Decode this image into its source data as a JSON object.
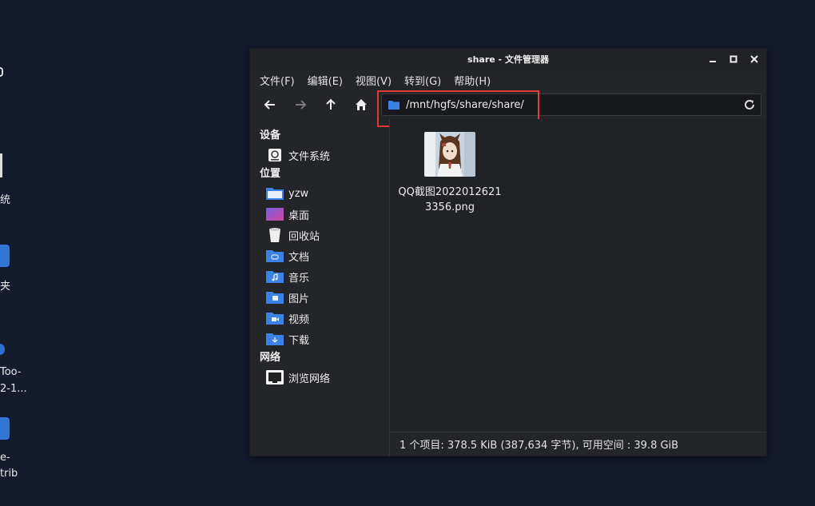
{
  "desktop": {
    "labels": [
      "统",
      "夹",
      "Too-",
      "2-1...",
      "e-",
      "trib"
    ]
  },
  "window": {
    "title": "share - 文件管理器"
  },
  "menu": [
    "文件(F)",
    "编辑(E)",
    "视图(V)",
    "转到(G)",
    "帮助(H)"
  ],
  "address": {
    "path": "/mnt/hgfs/share/share/"
  },
  "sidebar": {
    "sections": {
      "devices": "设备",
      "places": "位置",
      "network": "网络"
    },
    "devices": [
      {
        "label": "文件系统",
        "icon": "drive-icon"
      }
    ],
    "places": [
      {
        "label": "yzw",
        "icon": "home-folder-icon"
      },
      {
        "label": "桌面",
        "icon": "desktop-icon"
      },
      {
        "label": "回收站",
        "icon": "trash-icon"
      },
      {
        "label": "文档",
        "icon": "documents-folder-icon"
      },
      {
        "label": "音乐",
        "icon": "music-folder-icon"
      },
      {
        "label": "图片",
        "icon": "pictures-folder-icon"
      },
      {
        "label": "视频",
        "icon": "videos-folder-icon"
      },
      {
        "label": "下载",
        "icon": "downloads-folder-icon"
      }
    ],
    "network": [
      {
        "label": "浏览网络",
        "icon": "network-icon"
      }
    ]
  },
  "files": [
    {
      "name": "QQ截图20220126213356.png",
      "type": "image"
    }
  ],
  "status": "1 个项目: 378.5 KiB (387,634 字节), 可用空间 : 39.8 GiB",
  "colors": {
    "folder": "#3a82e6",
    "highlight": "#e03b3b",
    "desktop": "#141b2b"
  }
}
